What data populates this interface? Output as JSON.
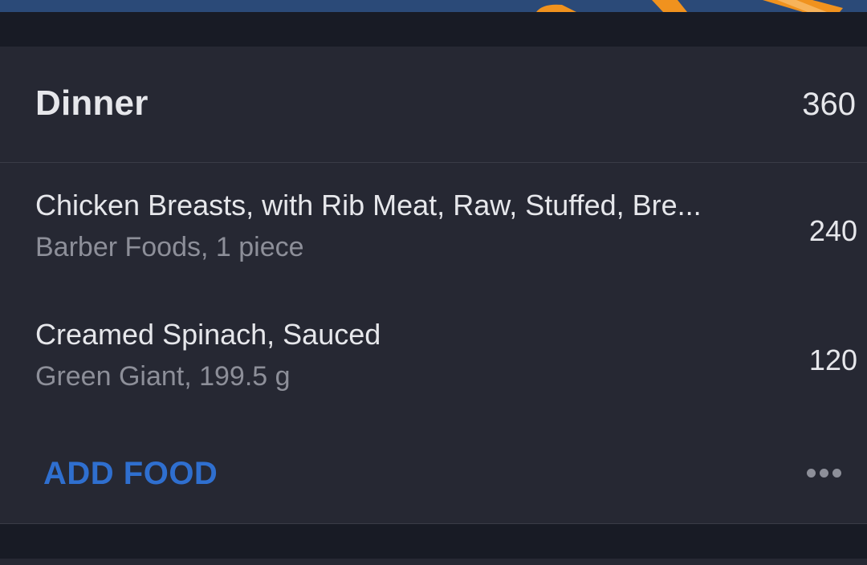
{
  "colors": {
    "banner": "#2b4a78",
    "banner_accent": "#f0921e",
    "background": "#181b25",
    "card": "#262833",
    "primary_text": "#e6e7eb",
    "secondary_text": "#8d8f99",
    "link": "#2f6fcf"
  },
  "meal": {
    "title": "Dinner",
    "total_calories": "360"
  },
  "foods": [
    {
      "name": "Chicken Breasts, with Rib Meat, Raw, Stuffed, Bre...",
      "detail": "Barber Foods, 1 piece",
      "calories": "240"
    },
    {
      "name": "Creamed Spinach, Sauced",
      "detail": "Green Giant, 199.5 g",
      "calories": "120"
    }
  ],
  "actions": {
    "add_food_label": "ADD FOOD",
    "more_icon": "more-horizontal-icon"
  }
}
